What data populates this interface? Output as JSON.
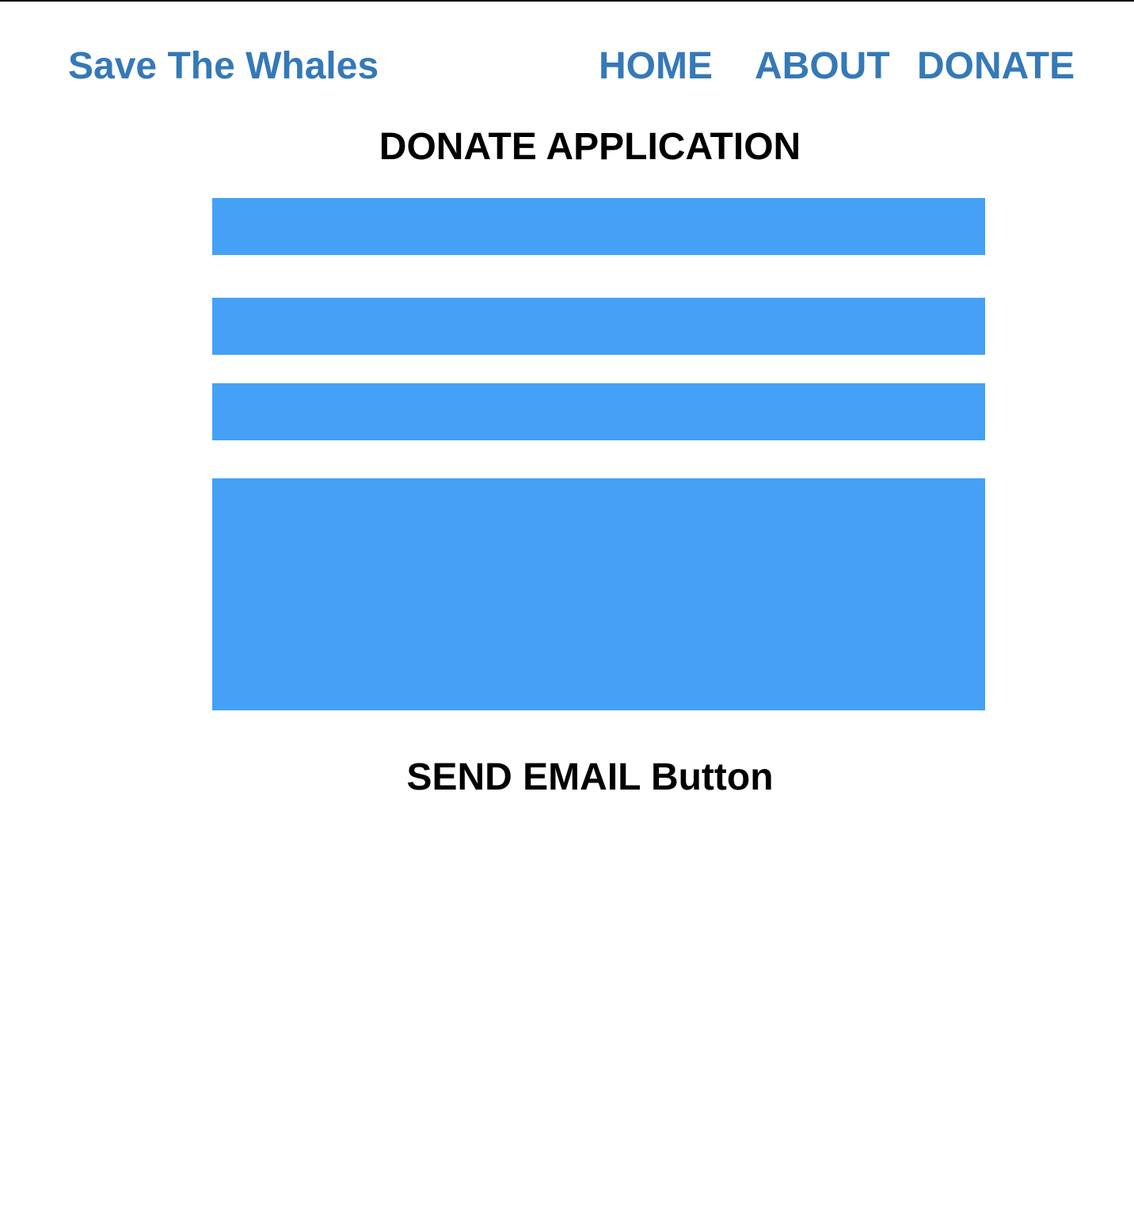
{
  "header": {
    "brand": "Save The Whales",
    "nav": {
      "home": "HOME",
      "about": "ABOUT",
      "donate": "DONATE"
    }
  },
  "main": {
    "title": "DONATE APPLICATION",
    "send_button_label": "SEND EMAIL Button"
  },
  "colors": {
    "brand": "#3579b7",
    "field_fill": "#44a1f6",
    "text": "#000000",
    "background": "#ffffff"
  }
}
